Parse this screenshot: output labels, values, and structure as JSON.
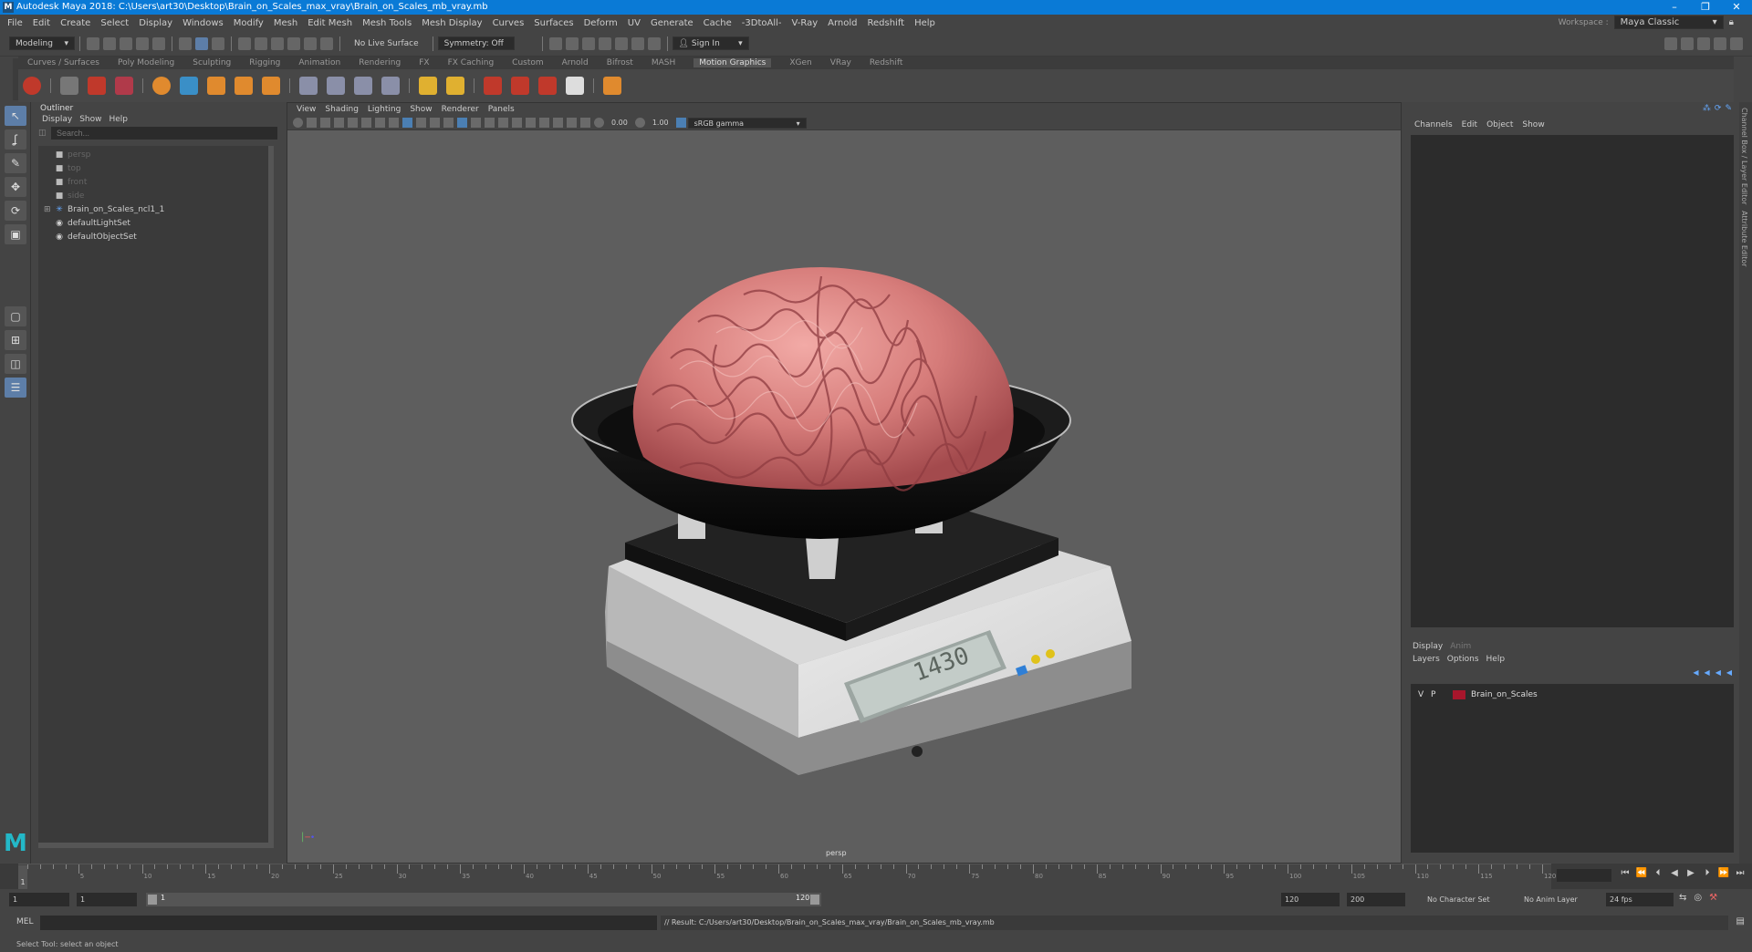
{
  "app": {
    "title": "Autodesk Maya 2018: C:\\Users\\art30\\Desktop\\Brain_on_Scales_max_vray\\Brain_on_Scales_mb_vray.mb",
    "logo_letter": "M"
  },
  "menubar": {
    "items": [
      "File",
      "Edit",
      "Create",
      "Select",
      "Display",
      "Windows",
      "Modify",
      "Mesh",
      "Edit Mesh",
      "Mesh Tools",
      "Mesh Display",
      "Curves",
      "Surfaces",
      "Deform",
      "UV",
      "Generate",
      "Cache",
      "-3DtoAll-",
      "V-Ray",
      "Arnold",
      "Redshift",
      "Help"
    ],
    "workspace_label": "Workspace :",
    "workspace_value": "Maya Classic"
  },
  "statusline": {
    "mode": "Modeling",
    "live_surface": "No Live Surface",
    "symmetry": "Symmetry: Off",
    "sign_in": "Sign In"
  },
  "shelf": {
    "tabs": [
      "Curves / Surfaces",
      "Poly Modeling",
      "Sculpting",
      "Rigging",
      "Animation",
      "Rendering",
      "FX",
      "FX Caching",
      "Custom",
      "Arnold",
      "Bifrost",
      "MASH",
      "Motion Graphics",
      "XGen",
      "VRay",
      "Redshift"
    ],
    "active_tab": "Motion Graphics"
  },
  "outliner": {
    "title": "Outliner",
    "menus": [
      "Display",
      "Show",
      "Help"
    ],
    "search_placeholder": "Search...",
    "items": [
      {
        "label": "persp",
        "icon": "camera-icon",
        "dim": true,
        "expand": ""
      },
      {
        "label": "top",
        "icon": "camera-icon",
        "dim": true,
        "expand": ""
      },
      {
        "label": "front",
        "icon": "camera-icon",
        "dim": true,
        "expand": ""
      },
      {
        "label": "side",
        "icon": "camera-icon",
        "dim": true,
        "expand": ""
      },
      {
        "label": "Brain_on_Scales_ncl1_1",
        "icon": "transform-icon",
        "dim": false,
        "expand": "⊞"
      },
      {
        "label": "defaultLightSet",
        "icon": "set-icon",
        "dim": false,
        "expand": ""
      },
      {
        "label": "defaultObjectSet",
        "icon": "set-icon",
        "dim": false,
        "expand": ""
      }
    ]
  },
  "viewport": {
    "menus": [
      "View",
      "Shading",
      "Lighting",
      "Show",
      "Renderer",
      "Panels"
    ],
    "exposure": "0.00",
    "gamma": "1.00",
    "color_space": "sRGB gamma",
    "camera_label": "persp",
    "scale_display": "1430"
  },
  "channelbox": {
    "menus": [
      "Channels",
      "Edit",
      "Object",
      "Show"
    ]
  },
  "layers": {
    "tabs": [
      "Display",
      "Anim"
    ],
    "menus": [
      "Layers",
      "Options",
      "Help"
    ],
    "rows": [
      {
        "v": "V",
        "p": "P",
        "name": "Brain_on_Scales",
        "color": "#a8162c"
      }
    ]
  },
  "sidetabs": [
    "Channel Box / Layer Editor",
    "Attribute Editor"
  ],
  "timeline": {
    "current_frame": "1",
    "tick_labels": [
      "5",
      "10",
      "15",
      "20",
      "25",
      "30",
      "35",
      "40",
      "45",
      "50",
      "55",
      "60",
      "65",
      "70",
      "75",
      "80",
      "85",
      "90",
      "95",
      "100",
      "105",
      "110",
      "115",
      "120"
    ],
    "end_frame": "120"
  },
  "range": {
    "start": "1",
    "start2": "1",
    "slider_start": "1",
    "slider_end": "120",
    "end": "120",
    "end2": "200",
    "character_set": "No Character Set",
    "anim_layer": "No Anim Layer",
    "fps": "24 fps"
  },
  "cmdline": {
    "label": "MEL",
    "result": "// Result: C:/Users/art30/Desktop/Brain_on_Scales_max_vray/Brain_on_Scales_mb_vray.mb"
  },
  "helpline": {
    "text": "Select Tool: select an object"
  }
}
